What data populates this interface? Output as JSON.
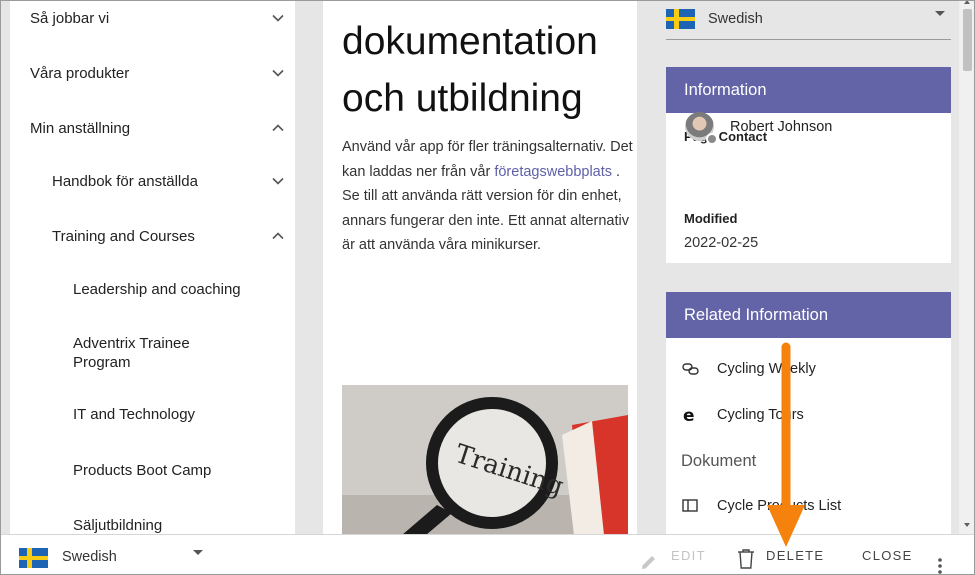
{
  "sidebar": {
    "items": [
      {
        "label": "Så jobbar vi",
        "expanded": false
      },
      {
        "label": "Våra produkter",
        "expanded": false
      },
      {
        "label": "Min anställning",
        "expanded": true
      },
      {
        "label": "Handbok för anställda",
        "expanded": false
      },
      {
        "label": "Training and Courses",
        "expanded": true
      },
      {
        "label": "Leadership and coaching"
      },
      {
        "label": "Adventrix Trainee Program"
      },
      {
        "label": "IT and Technology"
      },
      {
        "label": "Products Boot Camp"
      },
      {
        "label": "Säljutbildning"
      }
    ]
  },
  "article": {
    "title": "dokumentation och utbildning",
    "body_before_link": "Använd vår app för fler träningsalternativ. Det kan laddas ner från vår ",
    "link_text": "företagswebbplats",
    "body_after_link": " . Se till att använda rätt version för din enhet, annars fungerar den inte. Ett annat alternativ är att använda våra minikurser.",
    "image_text": "Training"
  },
  "language_selector": {
    "value": "Swedish"
  },
  "info_card": {
    "title": "Information",
    "contact_label": "Page Contact",
    "contact_name": "Robert Johnson",
    "modified_label": "Modified",
    "modified_value": "2022-02-25"
  },
  "related_card": {
    "title": "Related Information",
    "links": [
      {
        "label": "Cycling Weekly",
        "icon": "link-icon"
      },
      {
        "label": "Cycling Tours",
        "icon": "edge-browser-icon"
      }
    ],
    "section_title": "Dokument",
    "documents": [
      {
        "label": "Cycle Products List",
        "icon": "list-view-icon"
      }
    ]
  },
  "bottom_bar": {
    "language": "Swedish",
    "edit_label": "EDIT",
    "delete_label": "DELETE",
    "close_label": "CLOSE"
  },
  "colors": {
    "accent": "#6264a7",
    "link": "#5e5fa8",
    "annotation_arrow": "#f5820d",
    "flag_blue": "#1d64b4",
    "flag_yellow": "#f6cd14"
  }
}
